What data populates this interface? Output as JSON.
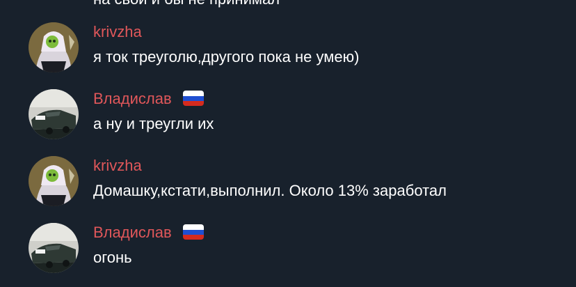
{
  "chat": {
    "partial_previous_text": "на свой и бы не принимал",
    "messages": [
      {
        "sender": "krivzha",
        "has_flag": false,
        "text": "я ток треуголю,другого пока не умею)"
      },
      {
        "sender": "Владислав",
        "has_flag": true,
        "text": "а ну и треугли их"
      },
      {
        "sender": "krivzha",
        "has_flag": false,
        "text": "Домашку,кстати,выполнил.  Около 13% заработал"
      },
      {
        "sender": "Владислав",
        "has_flag": true,
        "text": "огонь"
      }
    ]
  },
  "colors": {
    "background": "#18212c",
    "sender_name": "#e0575a",
    "message_text": "#ffffff",
    "flag_white": "#ffffff",
    "flag_blue": "#1f4fd1",
    "flag_red": "#d52b1e"
  },
  "icons": {
    "flag": "russia-flag-icon"
  }
}
